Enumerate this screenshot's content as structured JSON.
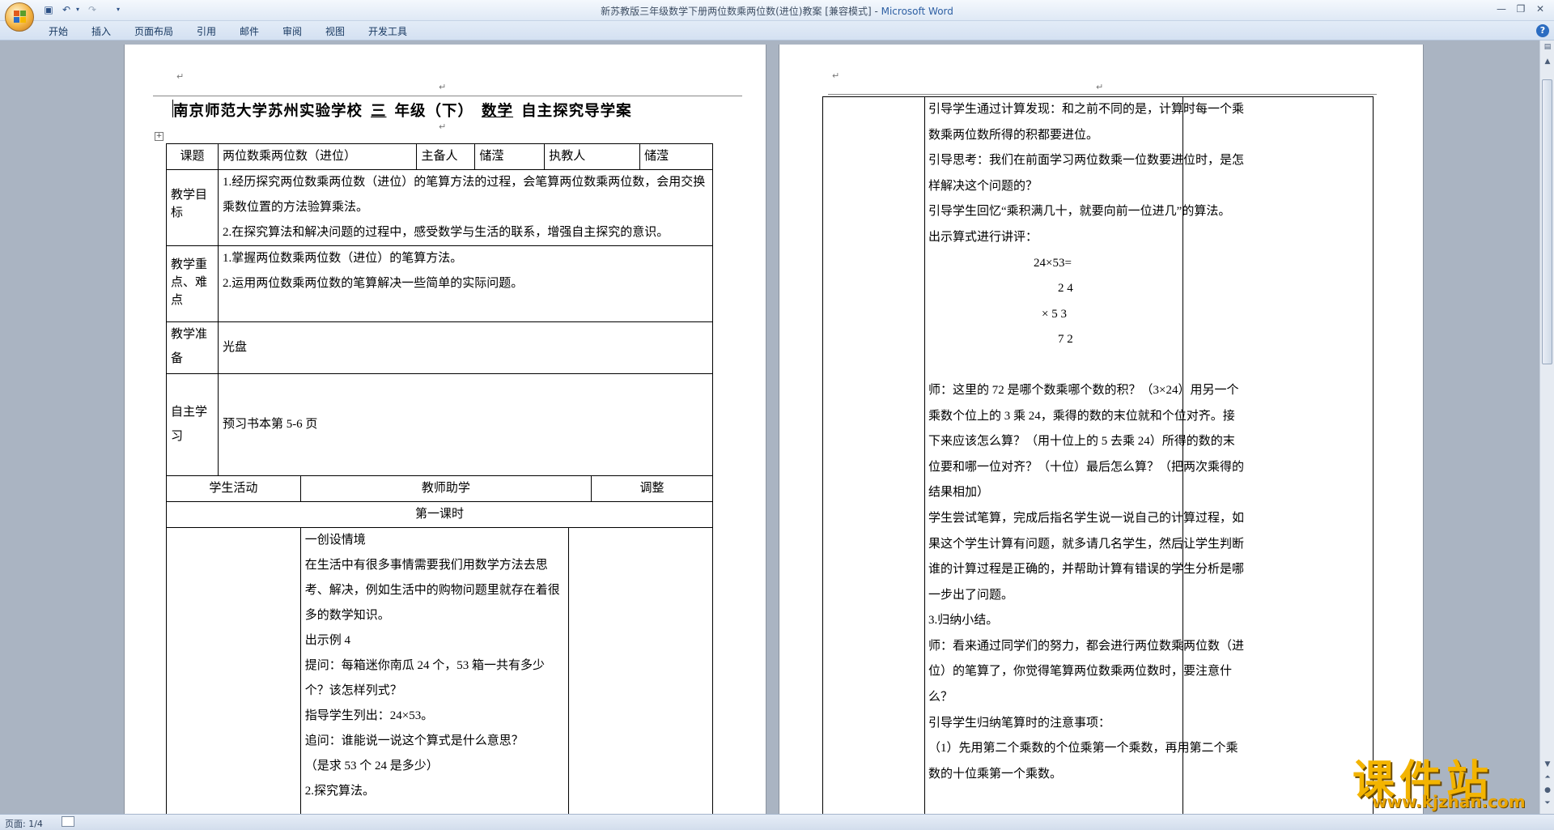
{
  "window": {
    "title": "新苏教版三年级数学下册两位数乘两位数(进位)教案 [兼容模式] - Microsoft Word",
    "title_doc": "新苏教版三年级数学下册两位数乘两位数(进位)教案 [兼容模式]",
    "title_app": "Microsoft Word"
  },
  "ribbon": {
    "tabs": [
      "开始",
      "插入",
      "页面布局",
      "引用",
      "邮件",
      "审阅",
      "视图",
      "开发工具"
    ]
  },
  "status": {
    "page": "页面: 1/4"
  },
  "page1": {
    "heading": {
      "school": "南京师范大学苏州实验学校",
      "grade_fill": "三",
      "grade_text": "年级（下）",
      "subject_fill": "数学",
      "tail": "自主探究导学案"
    },
    "table": {
      "r1": [
        "课题",
        "两位数乘两位数（进位）",
        "主备人",
        "储滢",
        "执教人",
        "储滢"
      ],
      "r2": {
        "label": "教学目标",
        "lines": [
          "1.经历探究两位数乘两位数（进位）的笔算方法的过程，会笔算两位数乘两位数，会用交换乘数位置的方法验算乘法。",
          "2.在探究算法和解决问题的过程中，感受数学与生活的联系，增强自主探究的意识。"
        ]
      },
      "r3": {
        "label": "教学重点、难点",
        "lines": [
          "1.掌握两位数乘两位数（进位）的笔算方法。",
          "2.运用两位数乘两位数的笔算解决一些简单的实际问题。"
        ]
      },
      "r4": {
        "label": "教学准备",
        "value": "光盘"
      },
      "r5": {
        "label": "自主学习",
        "value": "预习书本第 5-6 页"
      },
      "r6": [
        "学生活动",
        "教师助学",
        "调整"
      ],
      "r7": "第一课时",
      "r8": [
        "一创设情境",
        "在生活中有很多事情需要我们用数学方法去思考、解决，例如生活中的购物问题里就存在着很多的数学知识。",
        "出示例 4",
        "提问：每箱迷你南瓜 24 个，53 箱一共有多少个？该怎样列式？",
        "指导学生列出：24×53。",
        "追问：谁能说一说这个算式是什么意思？",
        "（是求 53 个 24 是多少）",
        "2.探究算法。"
      ]
    }
  },
  "page2": {
    "lines": [
      "引导学生通过计算发现：和之前不同的是，计算时每一个乘数乘两位数所得的积都要进位。",
      "引导思考：我们在前面学习两位数乘一位数要进位时，是怎样解决这个问题的？",
      "引导学生回忆“乘积满几十，就要向前一位进几”的算法。",
      "出示算式进行讲评：",
      "24×53=",
      "2 4",
      "× 5 3",
      "7 2",
      "师：这里的 72 是哪个数乘哪个数的积？（3×24）用另一个乘数个位上的 3 乘 24，乘得的数的末位就和个位对齐。接下来应该怎么算？（用十位上的 5 去乘 24）所得的数的末位要和哪一位对齐？（十位）最后怎么算？（把两次乘得的结果相加）",
      "学生尝试笔算，完成后指名学生说一说自己的计算过程，如果这个学生计算有问题，就多请几名学生，然后让学生判断谁的计算过程是正确的，并帮助计算有错误的学生分析是哪一步出了问题。",
      "3.归纳小结。",
      "师：看来通过同学们的努力，都会进行两位数乘两位数（进位）的笔算了，你觉得笔算两位数乘两位数时，要注意什么？",
      "引导学生归纳笔算时的注意事项：",
      "（1）先用第二个乘数的个位乘第一个乘数，再用第二个乘数的十位乘第一个乘数。"
    ]
  },
  "watermark": {
    "cn": "课件站",
    "url": "www.kjzhan.com"
  },
  "colors": {
    "accent": "#2d5fa3",
    "watermark": "#f3b400"
  }
}
